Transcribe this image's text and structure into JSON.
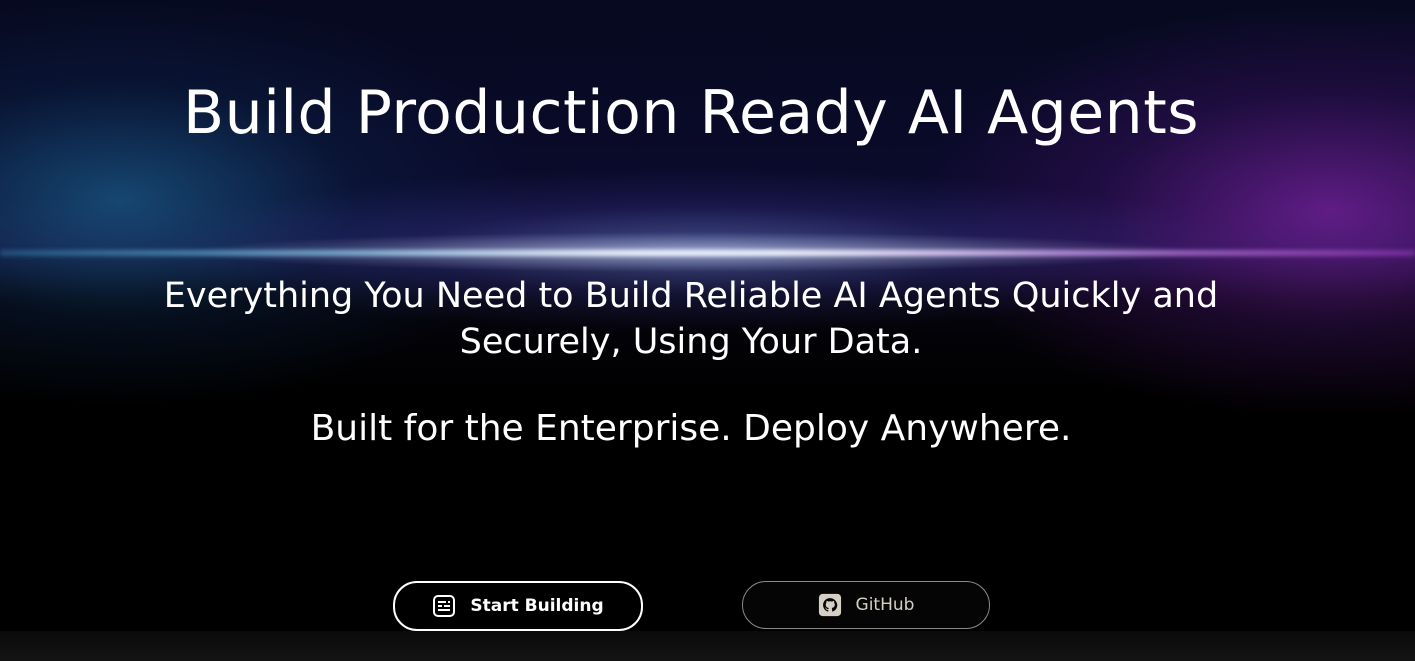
{
  "hero": {
    "title": "Build Production Ready AI Agents",
    "subtitle_line1": "Everything You Need to Build Reliable AI Agents Quickly and",
    "subtitle_line2": "Securely, Using Your Data.",
    "tagline": "Built for the Enterprise. Deploy Anywhere."
  },
  "buttons": {
    "start_label": "Start Building",
    "start_icon": "dashboard-icon",
    "github_label": "GitHub",
    "github_icon": "github-icon"
  },
  "colors": {
    "background": "#000000",
    "text": "#ffffff",
    "glow_left": "#1e78aa",
    "glow_right": "#9628be",
    "github_text": "#d6d0c4"
  }
}
